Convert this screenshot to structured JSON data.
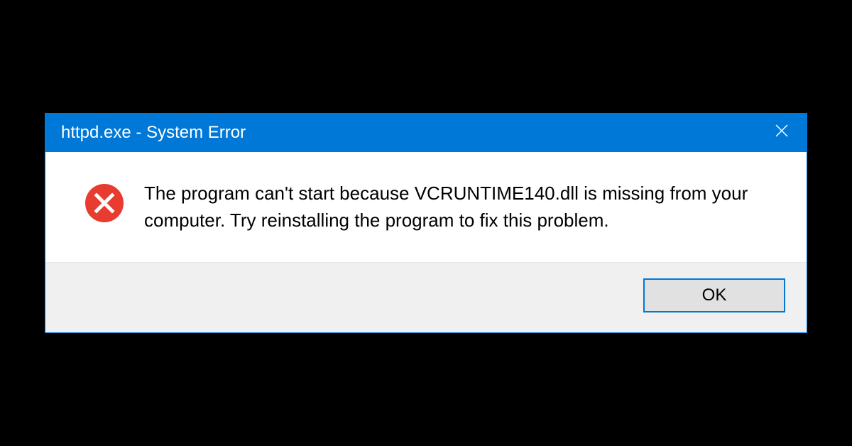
{
  "dialog": {
    "title": "httpd.exe - System Error",
    "message": "The program can't start because VCRUNTIME140.dll is missing from your computer. Try reinstalling the program to fix this problem.",
    "ok_label": "OK"
  },
  "colors": {
    "titlebar": "#0078d7",
    "error_icon": "#e73c2f"
  }
}
